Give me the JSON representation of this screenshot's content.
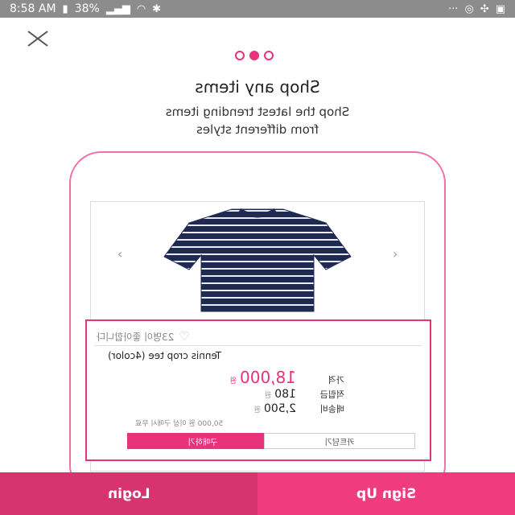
{
  "status_bar": {
    "time": "8:58 AM",
    "battery": "38%",
    "icons": [
      "signal-icon",
      "wifi-icon",
      "bluetooth-icon",
      "more-icon",
      "nfc-icon",
      "fan-icon",
      "image-icon"
    ]
  },
  "onboarding": {
    "title": "Shop any items",
    "subtitle": "Shop the latest trending items\nfrom different styles",
    "page_indicator": {
      "count": 3,
      "active_index": 1
    }
  },
  "product_card": {
    "likes_text": "23명이 좋아합니다",
    "product_name": "Tennis crop tee (4color)",
    "price_label": "가격",
    "price_value": "18,000",
    "price_unit": "원",
    "points_label": "적립금",
    "points_value": "180",
    "points_unit": "원",
    "shipping_label": "배송비",
    "shipping_value": "2,500",
    "shipping_unit": "원",
    "free_shipping_note": "50,000 원 이상 구매시 무료",
    "buy_button": "구매하기",
    "cart_button": "카트담기",
    "accent_color": "#e8327c"
  },
  "bottom_bar": {
    "login_label": "Login",
    "signup_label": "Sign Up"
  }
}
